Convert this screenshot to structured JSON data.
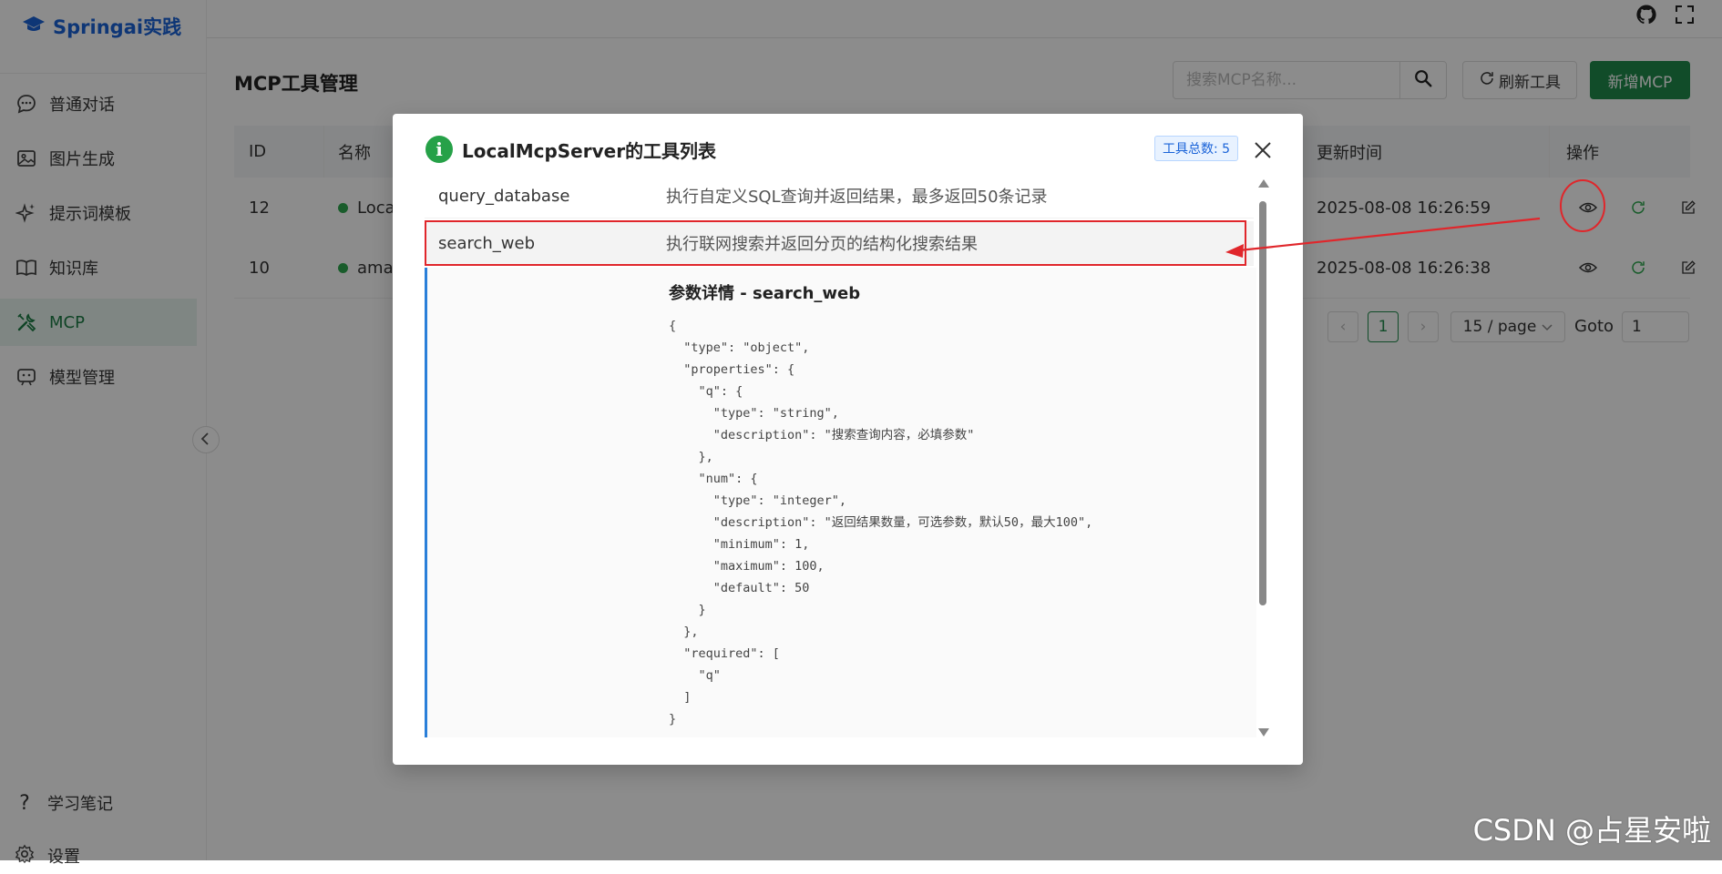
{
  "brand": {
    "name": "Springai实践"
  },
  "sidebar": {
    "items": [
      {
        "label": "普通对话",
        "icon": "chat-icon"
      },
      {
        "label": "图片生成",
        "icon": "image-icon"
      },
      {
        "label": "提示词模板",
        "icon": "sparkle-icon"
      },
      {
        "label": "知识库",
        "icon": "book-icon"
      },
      {
        "label": "MCP",
        "icon": "tools-icon",
        "active": true
      },
      {
        "label": "模型管理",
        "icon": "model-icon"
      }
    ],
    "bottom": [
      {
        "label": "学习笔记",
        "icon": "question-icon"
      },
      {
        "label": "设置",
        "icon": "settings-icon"
      }
    ]
  },
  "header": {
    "icons": [
      "github-icon",
      "fullscreen-icon"
    ]
  },
  "main": {
    "title": "MCP工具管理",
    "search": {
      "placeholder": "搜索MCP名称..."
    },
    "refresh_label": "刷新工具",
    "add_label": "新增MCP",
    "table": {
      "columns": [
        "ID",
        "名称",
        "更新时间",
        "操作"
      ],
      "rows": [
        {
          "id": "12",
          "name": "Loca",
          "updated": "2025-08-08 16:26:59"
        },
        {
          "id": "10",
          "name": "ama",
          "updated": "2025-08-08 16:26:38"
        }
      ]
    },
    "pagination": {
      "current": "1",
      "page_size": "15 / page",
      "goto_label": "Goto",
      "goto_value": "1"
    }
  },
  "modal": {
    "title": "LocalMcpServer的工具列表",
    "count_badge": "工具总数: 5",
    "tools": [
      {
        "name": "query_database",
        "desc": "执行自定义SQL查询并返回结果，最多返回50条记录"
      },
      {
        "name": "search_web",
        "desc": "执行联网搜索并返回分页的结构化搜索结果"
      }
    ],
    "detail_title": "参数详情 - search_web",
    "detail_json": "{\n  \"type\": \"object\",\n  \"properties\": {\n    \"q\": {\n      \"type\": \"string\",\n      \"description\": \"搜索查询内容，必填参数\"\n    },\n    \"num\": {\n      \"type\": \"integer\",\n      \"description\": \"返回结果数量，可选参数，默认50，最大100\",\n      \"minimum\": 1,\n      \"maximum\": 100,\n      \"default\": 50\n    }\n  },\n  \"required\": [\n    \"q\"\n  ]\n}"
  },
  "watermark": "CSDN @占星安啦",
  "colors": {
    "accent_green": "#1f8a4c",
    "brand_blue": "#1a63d8",
    "annotation_red": "#e0262b",
    "detail_border_blue": "#2a7fd9"
  }
}
